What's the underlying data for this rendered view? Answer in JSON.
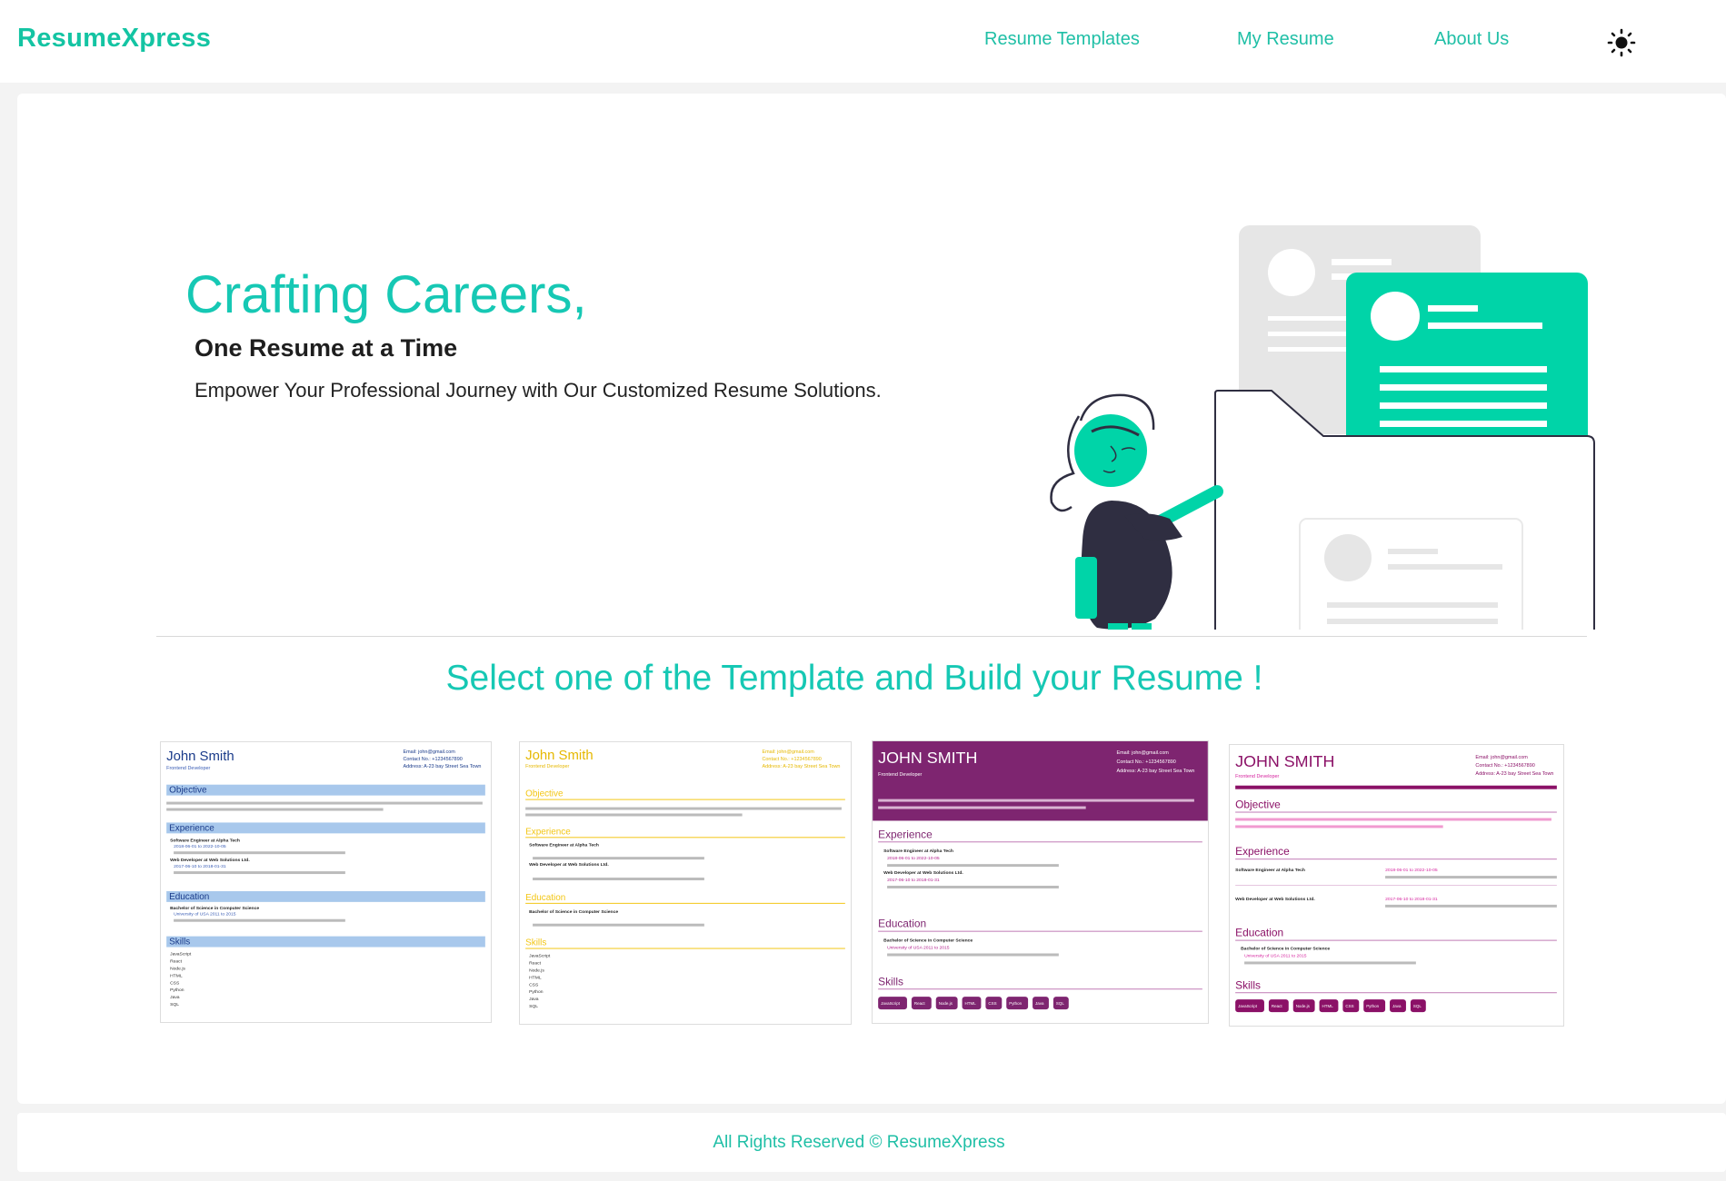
{
  "brand": {
    "name": "ResumeXpress",
    "color": "#14c4a3"
  },
  "nav": {
    "items": [
      {
        "label": "Resume Templates"
      },
      {
        "label": "My Resume"
      },
      {
        "label": "About Us"
      }
    ],
    "theme_toggle_icon": "sun-icon"
  },
  "hero": {
    "title": "Crafting Careers,",
    "subtitle": "One Resume at a Time",
    "tagline": "Empower Your Professional Journey with Our Customized Resume Solutions.",
    "illustration_icon": "person-with-resume-folder-illustration"
  },
  "templates": {
    "heading": "Select one of the Template and Build your Resume !",
    "items": [
      {
        "name": "John Smith",
        "role": "Frontend Developer",
        "accent": "#a8c8ec",
        "text_accent": "#1a3b8a",
        "email": "Email: john@gmail.com",
        "contact": "Contact No.: +1234567890",
        "address": "Address: A-23 bay Street Sea Town",
        "sections": [
          "Objective",
          "Experience",
          "Education",
          "Skills"
        ],
        "jobs": [
          "Software Engineer at Alpha Tech",
          "Web Developer at Web Solutions Ltd."
        ],
        "dates": [
          "2018-06-01 to 2022-10-05",
          "2017-06-10 to 2018-01-31"
        ],
        "degree": "Bachelor of Science in Computer Science",
        "school": "University of USA 2011 to 2015",
        "skills": [
          "JavaScript",
          "React",
          "Node.js",
          "HTML",
          "CSS",
          "Python",
          "Java",
          "SQL"
        ]
      },
      {
        "name": "John Smith",
        "role": "Frontend Developer",
        "accent": "#f3c614",
        "text_accent": "#e6b800",
        "email": "Email: john@gmail.com",
        "contact": "Contact No.: +1234567890",
        "address": "Address: A-23 bay Street Sea Town",
        "sections": [
          "Objective",
          "Experience",
          "Education",
          "Skills"
        ],
        "jobs": [
          "Software Engineer at Alpha Tech",
          "Web Developer at Web Solutions Ltd."
        ],
        "degree": "Bachelor of Science in Computer Science",
        "skills": [
          "JavaScript",
          "React",
          "Node.js",
          "HTML",
          "CSS",
          "Python",
          "Java",
          "SQL"
        ]
      },
      {
        "name": "JOHN SMITH",
        "role": "Frontend Developer",
        "accent": "#7e2570",
        "text_accent": "#7e2570",
        "email": "Email: john@gmail.com",
        "contact": "Contact No.: +1234567890",
        "address": "Address: A-23 bay Street Sea Town",
        "sections": [
          "Experience",
          "Education",
          "Skills"
        ],
        "jobs": [
          "Software Engineer at Alpha Tech",
          "Web Developer at Web Solutions Ltd."
        ],
        "dates": [
          "2018-06-01 to 2022-10-05",
          "2017-06-10 to 2018-01-31"
        ],
        "degree": "Bachelor of Science in Computer Science",
        "school": "University of USA 2011 to 2015",
        "skills": [
          "JavaScript",
          "React",
          "Node.js",
          "HTML",
          "CSS",
          "Python",
          "Java",
          "SQL"
        ]
      },
      {
        "name": "JOHN SMITH",
        "role": "Frontend Developer",
        "accent": "#8b1167",
        "text_accent": "#d6249f",
        "email": "Email: john@gmail.com",
        "contact": "Contact No.: +1234567890",
        "address": "Address: A-23 bay Street Sea Town",
        "sections": [
          "Objective",
          "Experience",
          "Education",
          "Skills"
        ],
        "jobs": [
          "Software Engineer at Alpha Tech",
          "Web Developer at Web Solutions Ltd."
        ],
        "dates": [
          "2018-06-01 to 2022-10-05",
          "2017-06-10 to 2018-01-31"
        ],
        "degree": "Bachelor of Science in Computer Science",
        "school": "University of USA 2011 to 2015",
        "skills": [
          "JavaScript",
          "React",
          "Node.js",
          "HTML",
          "CSS",
          "Python",
          "Java",
          "SQL"
        ]
      }
    ]
  },
  "footer": {
    "text": "All Rights Reserved © ResumeXpress"
  }
}
